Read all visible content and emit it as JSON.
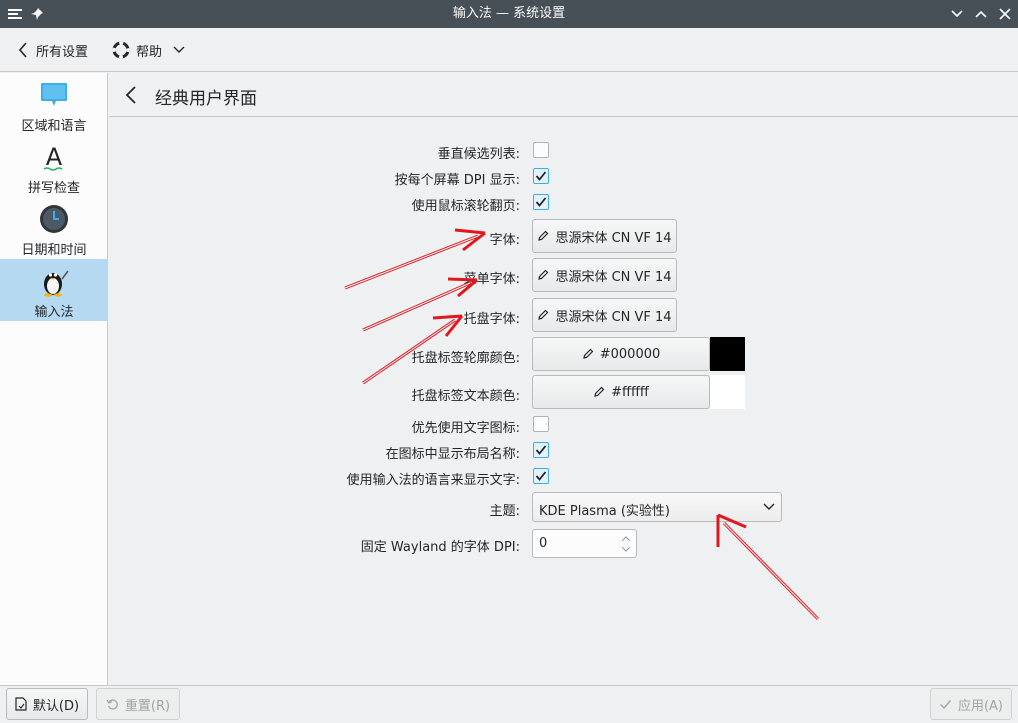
{
  "window": {
    "title": "输入法 — 系统设置",
    "menu_icon": "window-menu-icon",
    "pin_icon": "pin-icon",
    "controls": [
      "chevron-down-icon",
      "chevron-up-icon",
      "close-icon"
    ]
  },
  "toolbar": {
    "back_label": "所有设置",
    "help_label": "帮助"
  },
  "sidebar": {
    "items": [
      {
        "label": "区域和语言",
        "icon": "region-language-icon",
        "active": false
      },
      {
        "label": "拼写检查",
        "icon": "spellcheck-icon",
        "active": false
      },
      {
        "label": "日期和时间",
        "icon": "clock-icon",
        "active": false
      },
      {
        "label": "输入法",
        "icon": "input-method-penguin-icon",
        "active": true
      }
    ]
  },
  "page": {
    "title": "经典用户界面"
  },
  "settings": {
    "vertical_list": {
      "label": "垂直候选列表:",
      "checked": false
    },
    "per_screen_dpi": {
      "label": "按每个屏幕 DPI 显示:",
      "checked": true
    },
    "wheel_page": {
      "label": "使用鼠标滚轮翻页:",
      "checked": true
    },
    "font": {
      "label": "字体:",
      "value": "思源宋体 CN VF 14"
    },
    "menu_font": {
      "label": "菜单字体:",
      "value": "思源宋体 CN VF 14"
    },
    "tray_font": {
      "label": "托盘字体:",
      "value": "思源宋体 CN VF 14"
    },
    "tray_outline_color": {
      "label": "托盘标签轮廓颜色:",
      "value": "#000000",
      "swatch": "#000000"
    },
    "tray_text_color": {
      "label": "托盘标签文本颜色:",
      "value": "#ffffff",
      "swatch": "#ffffff"
    },
    "prefer_text_icon": {
      "label": "优先使用文字图标:",
      "checked": false
    },
    "show_layout_name": {
      "label": "在图标中显示布局名称:",
      "checked": true
    },
    "use_im_language": {
      "label": "使用输入法的语言来显示文字:",
      "checked": true
    },
    "theme": {
      "label": "主题:",
      "value": "KDE Plasma (实验性)"
    },
    "wayland_dpi": {
      "label": "固定 Wayland 的字体 DPI:",
      "value": "0"
    }
  },
  "footer": {
    "defaults_label": "默认(D)",
    "reset_label": "重置(R)",
    "apply_label": "应用(A)"
  },
  "colors": {
    "titlebar": "#475057",
    "accent": "#3daee9",
    "sidebar_active": "#b6d9f2",
    "annotation_arrow": "#e0181e"
  }
}
